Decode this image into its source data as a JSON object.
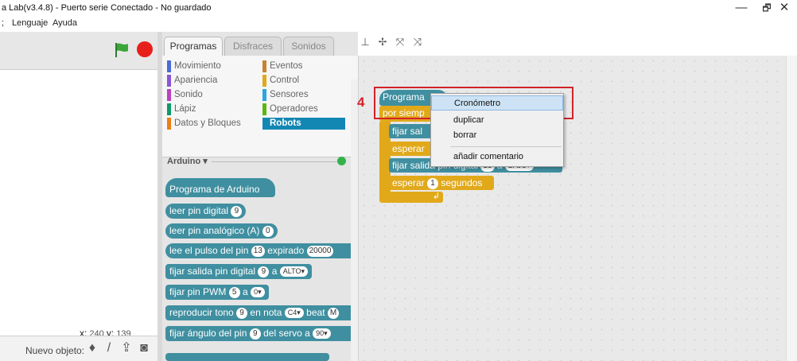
{
  "window": {
    "title": "a Lab(v3.4.8) - Puerto serie Conectado - No guardado",
    "minimize": "—",
    "restore": "🗗",
    "close": "✕"
  },
  "menubar": {
    "items": [
      ";",
      "Lenguaje",
      "Ayuda"
    ]
  },
  "stage": {
    "x_label": "x:",
    "x_value": "240",
    "y_label": "y:",
    "y_value": "139",
    "new_sprite_label": "Nuevo objeto:",
    "icons": [
      "character-library-icon",
      "paint-brush-icon",
      "upload-icon",
      "camera-icon"
    ]
  },
  "palette": {
    "tabs": [
      "Programas",
      "Disfraces",
      "Sonidos"
    ],
    "active_tab": "Programas",
    "categories": [
      {
        "label": "Movimiento",
        "color": "#4a6cd4"
      },
      {
        "label": "Eventos",
        "color": "#c88330"
      },
      {
        "label": "Apariencia",
        "color": "#8a55d7"
      },
      {
        "label": "Control",
        "color": "#e1a91a"
      },
      {
        "label": "Sonido",
        "color": "#bb42c3"
      },
      {
        "label": "Sensores",
        "color": "#2ca5e2"
      },
      {
        "label": "Lápiz",
        "color": "#0e9a6c"
      },
      {
        "label": "Operadores",
        "color": "#5cb712"
      },
      {
        "label": "Datos y Bloques",
        "color": "#ee7d16"
      },
      {
        "label": "Robots",
        "color": "#1387b3"
      }
    ],
    "selected_category": "Robots",
    "section": "Arduino ▾",
    "blocks": {
      "b1": "Programa de Arduino",
      "b2_text": "leer pin digital",
      "b2_n": "9",
      "b3_text": "leer pin analógico (A)",
      "b3_n": "0",
      "b4_text": "lee el pulso del pin",
      "b4_n": "13",
      "b4_mid": "expirado",
      "b4_n2": "20000",
      "b5_text": "fijar salida pin digital",
      "b5_n": "9",
      "b5_a": "a",
      "b5_v": "ALTO▾",
      "b6_text": "fijar pin PWM",
      "b6_n": "5",
      "b6_a": "a",
      "b6_v": "0▾",
      "b7_text": "reproducir tono",
      "b7_n": "9",
      "b7_mid": "en nota",
      "b7_v": "C4▾",
      "b7_end": "beat",
      "b7_tail": "M",
      "b8_text": "fijar ángulo del pin",
      "b8_n": "9",
      "b8_mid": "del servo a",
      "b8_v": "90▾"
    }
  },
  "script": {
    "step": "4",
    "hat": "Programa",
    "forever": "por siemp",
    "s1": "fijar sal",
    "s2": "esperar",
    "s3_text": "fijar salida pin digital",
    "s3_n": "13",
    "s3_a": "a",
    "s3_v": "BAJO▾",
    "s4_text": "esperar",
    "s4_n": "1",
    "s4_unit": "segundos",
    "arrow": "↲"
  },
  "context_menu": {
    "items": [
      "Cronómetro",
      "duplicar",
      "borrar",
      "añadir comentario"
    ],
    "selected": "Cronómetro"
  }
}
